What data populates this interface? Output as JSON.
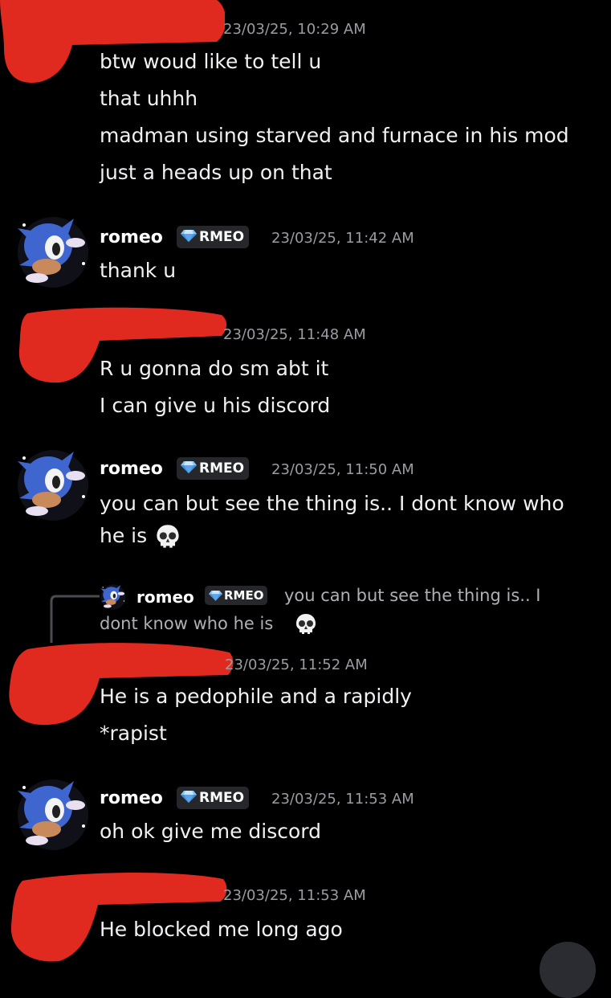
{
  "messages": [
    {
      "timestamp": "23/03/25, 10:29 AM",
      "lines": [
        "btw woud like to tell u",
        "that uhhh",
        "madman using starved and furnace in his mod",
        "just a heads up on that"
      ]
    },
    {
      "author": "romeo",
      "tag": "RMEO",
      "timestamp": "23/03/25, 11:42 AM",
      "lines": [
        "thank u"
      ]
    },
    {
      "timestamp": "23/03/25, 11:48 AM",
      "lines": [
        "R u gonna do sm abt it",
        "I can give u his discord"
      ]
    },
    {
      "author": "romeo",
      "tag": "RMEO",
      "timestamp": "23/03/25, 11:50 AM",
      "lines": [
        "you can but see the thing is.. I dont know who",
        "he is"
      ]
    },
    {
      "reply": {
        "author": "romeo",
        "tag": "RMEO",
        "text_line1": "you can but see the thing is.. I",
        "text_line2": "dont know who he is"
      },
      "timestamp": "23/03/25, 11:52 AM",
      "lines": [
        "He is a pedophile and a rapidly",
        "*rapist"
      ]
    },
    {
      "author": "romeo",
      "tag": "RMEO",
      "timestamp": "23/03/25, 11:53 AM",
      "lines": [
        "oh ok give me discord"
      ]
    },
    {
      "timestamp": "23/03/25, 11:53 AM",
      "lines": [
        "He blocked me long ago"
      ]
    }
  ],
  "icons": {
    "emoji": "skull-emoji",
    "tag_icon": "diamond-icon",
    "redaction_color": "#e0291f"
  },
  "colors": {
    "background": "#000000",
    "text": "#f0f1f3",
    "timestamp": "#9a9ca3",
    "tag_bg": "#26272b"
  }
}
